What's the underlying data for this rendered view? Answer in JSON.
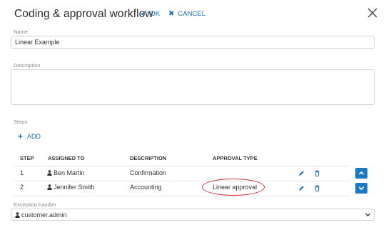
{
  "dialog": {
    "title": "Coding & approval workflow",
    "ok_label": "OK",
    "cancel_label": "CANCEL"
  },
  "name_field": {
    "label": "Name",
    "value": "Linear Example"
  },
  "description_field": {
    "label": "Description",
    "value": ""
  },
  "steps": {
    "label": "Steps",
    "add_label": "ADD",
    "columns": [
      "STEP",
      "ASSIGNED TO",
      "DESCRIPTION",
      "APPROVAL TYPE"
    ],
    "rows": [
      {
        "step": "1",
        "assigned_to": "Ben Martin",
        "description": "Confirmation",
        "approval_type": ""
      },
      {
        "step": "2",
        "assigned_to": "Jennifer Smith",
        "description": "Accounting",
        "approval_type": "Linear approval"
      }
    ]
  },
  "exception_handler": {
    "label": "Exception handler",
    "value": "customer.admin"
  },
  "colors": {
    "accent": "#1a73b8",
    "button_bg": "#1a7bc4",
    "highlight": "#d9373b"
  },
  "icons": [
    "check-icon",
    "cancel-x-icon",
    "close-icon",
    "plus-icon",
    "person-icon",
    "pencil-icon",
    "trash-icon",
    "chevron-up-icon",
    "chevron-down-icon"
  ]
}
